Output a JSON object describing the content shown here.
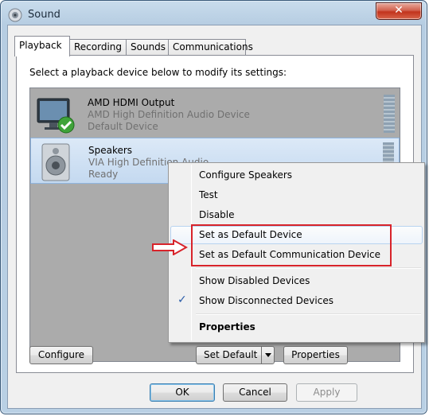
{
  "window": {
    "title": "Sound",
    "close_glyph": "✕",
    "icon": "speaker-app-icon"
  },
  "tabs": [
    {
      "label": "Playback",
      "active": true
    },
    {
      "label": "Recording",
      "active": false
    },
    {
      "label": "Sounds",
      "active": false
    },
    {
      "label": "Communications",
      "active": false
    }
  ],
  "instruction": "Select a playback device below to modify its settings:",
  "devices": [
    {
      "name": "AMD HDMI Output",
      "description": "AMD High Definition Audio Device",
      "status": "Default Device",
      "icon": "monitor-icon",
      "badge": "green-check-icon"
    },
    {
      "name": "Speakers",
      "description": "VIA High Definition Audio",
      "status": "Ready",
      "icon": "speaker-icon",
      "selected": true
    }
  ],
  "context_menu": {
    "items": [
      {
        "label": "Configure Speakers"
      },
      {
        "label": "Test"
      },
      {
        "label": "Disable"
      },
      {
        "label": "Set as Default Device"
      },
      {
        "label": "Set as Default Communication Device"
      },
      {
        "label": "Show Disabled Devices"
      },
      {
        "label": "Show Disconnected Devices",
        "checked": true
      },
      {
        "label": "Properties",
        "bold": true
      }
    ],
    "check_glyph": "✓"
  },
  "buttons": {
    "configure": "Configure",
    "set_default": "Set Default",
    "properties": "Properties",
    "ok": "OK",
    "cancel": "Cancel",
    "apply": "Apply"
  },
  "colors": {
    "annotation": "#d8232a",
    "selection": "#c4d9f0",
    "list_background": "#ababab"
  }
}
